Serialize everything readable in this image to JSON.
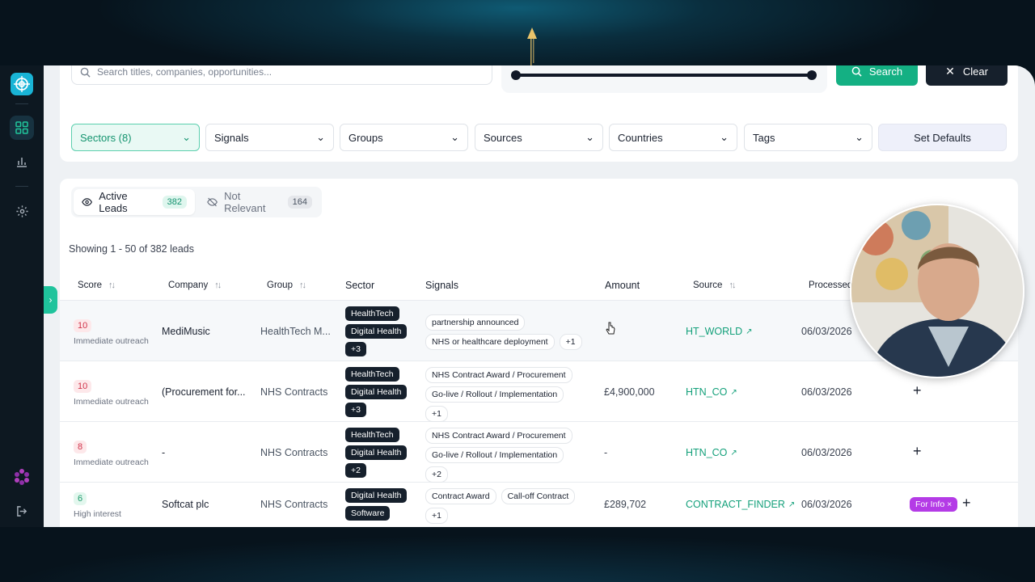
{
  "colors": {
    "accent": "#14b083",
    "dark": "#16202c",
    "link": "#13a07a",
    "danger": "#d0334a",
    "purple": "#b43be6"
  },
  "search": {
    "placeholder": "Search titles, companies, opportunities...",
    "button_label": "Search",
    "clear_label": "Clear"
  },
  "range": {
    "min_fraction": 0.0,
    "max_fraction": 1.0
  },
  "filters": [
    {
      "label": "Sectors (8)",
      "active": true
    },
    {
      "label": "Signals",
      "active": false
    },
    {
      "label": "Groups",
      "active": false
    },
    {
      "label": "Sources",
      "active": false
    },
    {
      "label": "Countries",
      "active": false
    },
    {
      "label": "Tags",
      "active": false
    }
  ],
  "set_defaults_label": "Set Defaults",
  "tabs": {
    "active": {
      "label": "Active Leads",
      "count": "382"
    },
    "inactive": {
      "label": "Not Relevant",
      "count": "164"
    }
  },
  "showing_text": "Showing 1 - 50 of 382 leads",
  "columns": {
    "score": "Score",
    "company": "Company",
    "group": "Group",
    "sector": "Sector",
    "signals": "Signals",
    "amount": "Amount",
    "source": "Source",
    "processed": "Processed"
  },
  "rows": [
    {
      "score": "10",
      "score_label": "Immediate outreach",
      "company": "MediMusic",
      "group": "HealthTech M...",
      "sectors": [
        "HealthTech",
        "Digital Health",
        "+3"
      ],
      "signals": [
        "partnership announced",
        "NHS or healthcare deployment",
        "+1"
      ],
      "amount": "",
      "source": "HT_WORLD",
      "processed": "06/03/2026"
    },
    {
      "score": "10",
      "score_label": "Immediate outreach",
      "company": "(Procurement for...",
      "group": "NHS Contracts",
      "sectors": [
        "HealthTech",
        "Digital Health",
        "+3"
      ],
      "signals": [
        "NHS Contract Award / Procurement",
        "Go-live / Rollout / Implementation",
        "+1"
      ],
      "amount": "£4,900,000",
      "source": "HTN_CO",
      "processed": "06/03/2026",
      "action": "+"
    },
    {
      "score": "8",
      "score_label": "Immediate outreach",
      "company": "-",
      "group": "NHS Contracts",
      "sectors": [
        "HealthTech",
        "Digital Health",
        "+2"
      ],
      "signals": [
        "NHS Contract Award / Procurement",
        "Go-live / Rollout / Implementation",
        "+2"
      ],
      "amount": "-",
      "source": "HTN_CO",
      "processed": "06/03/2026",
      "action": "+"
    },
    {
      "score": "6",
      "score_label": "High interest",
      "company": "Softcat plc",
      "group": "NHS Contracts",
      "sectors": [
        "Digital Health",
        "Software"
      ],
      "signals": [
        "Contract Award",
        "Call-off Contract",
        "+1"
      ],
      "amount": "£289,702",
      "source": "CONTRACT_FINDER",
      "processed": "06/03/2026",
      "tag": "For Info ×",
      "action": "+"
    }
  ]
}
